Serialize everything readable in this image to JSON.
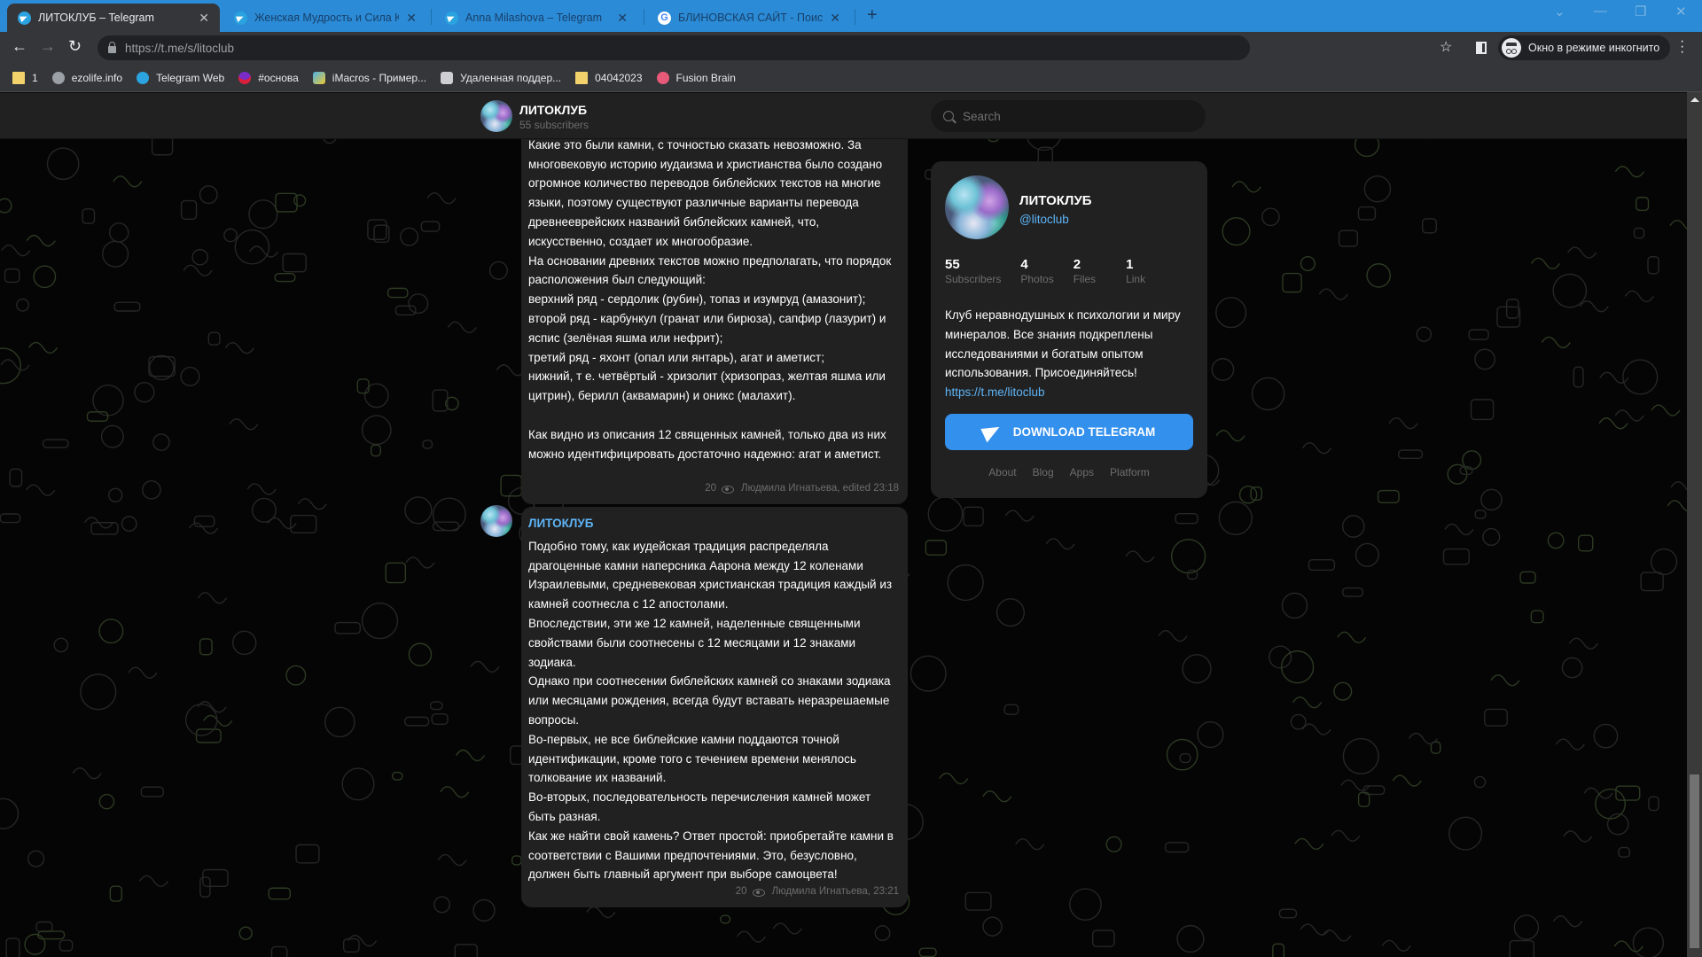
{
  "browser": {
    "tabs": [
      {
        "label": "ЛИТОКЛУБ – Telegram",
        "icon": "telegram-icon",
        "active": true
      },
      {
        "label": "Женская Мудрость и Сила Кри",
        "icon": "telegram-icon",
        "active": false
      },
      {
        "label": "Anna Milashova – Telegram",
        "icon": "telegram-icon",
        "active": false
      },
      {
        "label": "БЛИНОВСКАЯ САЙТ - Поиск в",
        "icon": "google-icon",
        "active": false
      }
    ],
    "close_glyph": "✕",
    "new_tab_glyph": "+",
    "url": "https://t.me/s/litoclub",
    "incognito_label": "Окно в режиме инкогнито",
    "bookmarks": [
      {
        "label": "1",
        "icon": "folder-icon"
      },
      {
        "label": "ezolife.info",
        "icon": "globe-icon"
      },
      {
        "label": "Telegram Web",
        "icon": "telegram-icon"
      },
      {
        "label": "#основа",
        "icon": "badge-icon"
      },
      {
        "label": "iMacros - Пример...",
        "icon": "imacros-icon"
      },
      {
        "label": "Удаленная поддер...",
        "icon": "remote-icon"
      },
      {
        "label": "04042023",
        "icon": "folder-icon"
      },
      {
        "label": "Fusion Brain",
        "icon": "brain-icon"
      }
    ]
  },
  "header": {
    "title": "ЛИТОКЛУБ",
    "subtitle": "55 subscribers",
    "search_placeholder": "Search"
  },
  "messages": [
    {
      "author": "",
      "text": "определенном порядке: по три камня в четыре ряда.\nКакие это были камни, с точностью сказать невозможно. За многовековую историю иудаизма и христианства было создано огромное количество переводов библейских текстов на многие языки, поэтому существуют различные варианты перевода древнееврейских названий библейских камней, что, искусственно, создает их многообразие.\nНа основании древних текстов можно предполагать, что порядок расположения был следующий:\nверхний ряд - сердолик (рубин), топаз и изумруд (амазонит);\nвторой ряд - карбункул (гранат или бирюза), сапфир (лазурит) и яспис (зелёная яшма или нефрит);\nтретий ряд - яхонт (опал или янтарь), агат и аметист;\nнижний, т е. четвёртый - хризолит (хризопраз, желтая яшма или цитрин), берилл (аквамарин) и оникс (малахит).\n\nКак видно из описания 12 священных камней, только два из них можно идентифицировать достаточно надежно: агат и аметист.",
      "views": "20",
      "signature": "Людмила Игнатьева, edited",
      "time": "23:18"
    },
    {
      "author": "ЛИТОКЛУБ",
      "text": "Подобно тому, как иудейская традиция распределяла драгоценные камни наперсника Аарона между 12 коленами Израилевыми, средневековая христианская традиция каждый из камней соотнесла с 12 апостолами.\nВпоследствии, эти же 12 камней, наделенные священными свойствами были соотнесены с 12 месяцами и 12 знаками зодиака.\nОднако при соотнесении библейских камней со знаками зодиака или месяцами рождения, всегда будут вставать неразрешаемые вопросы.\nВо-первых, не все библейские камни поддаются точной идентификации, кроме того с течением времени менялось толкование их названий.\nВо-вторых, последовательность перечисления камней может быть разная.\nКак же найти свой камень? Ответ простой: приобретайте камни в соответствии с Вашими предпочтениями. Это, безусловно, должен быть главный аргумент при выборе самоцвета!",
      "views": "20",
      "signature": "Людмила Игнатьева,",
      "time": "23:21"
    }
  ],
  "channel_card": {
    "title": "ЛИТОКЛУБ",
    "handle": "@litoclub",
    "stats": [
      {
        "value": "55",
        "label": "Subscribers"
      },
      {
        "value": "4",
        "label": "Photos"
      },
      {
        "value": "2",
        "label": "Files"
      },
      {
        "value": "1",
        "label": "Link"
      }
    ],
    "description": "Клуб неравнодушных к психологии и миру минералов. Все знания подкреплены исследованиями и богатым опытом использования. Присоединяйтесь!",
    "link": "https://t.me/litoclub",
    "download_label": "DOWNLOAD TELEGRAM",
    "footer_links": [
      "About",
      "Blog",
      "Apps",
      "Platform"
    ]
  },
  "colors": {
    "accent": "#3390ec",
    "link": "#5eb5f7",
    "bubble": "#212121",
    "chrome_tab_bar": "#2b8bd6"
  }
}
